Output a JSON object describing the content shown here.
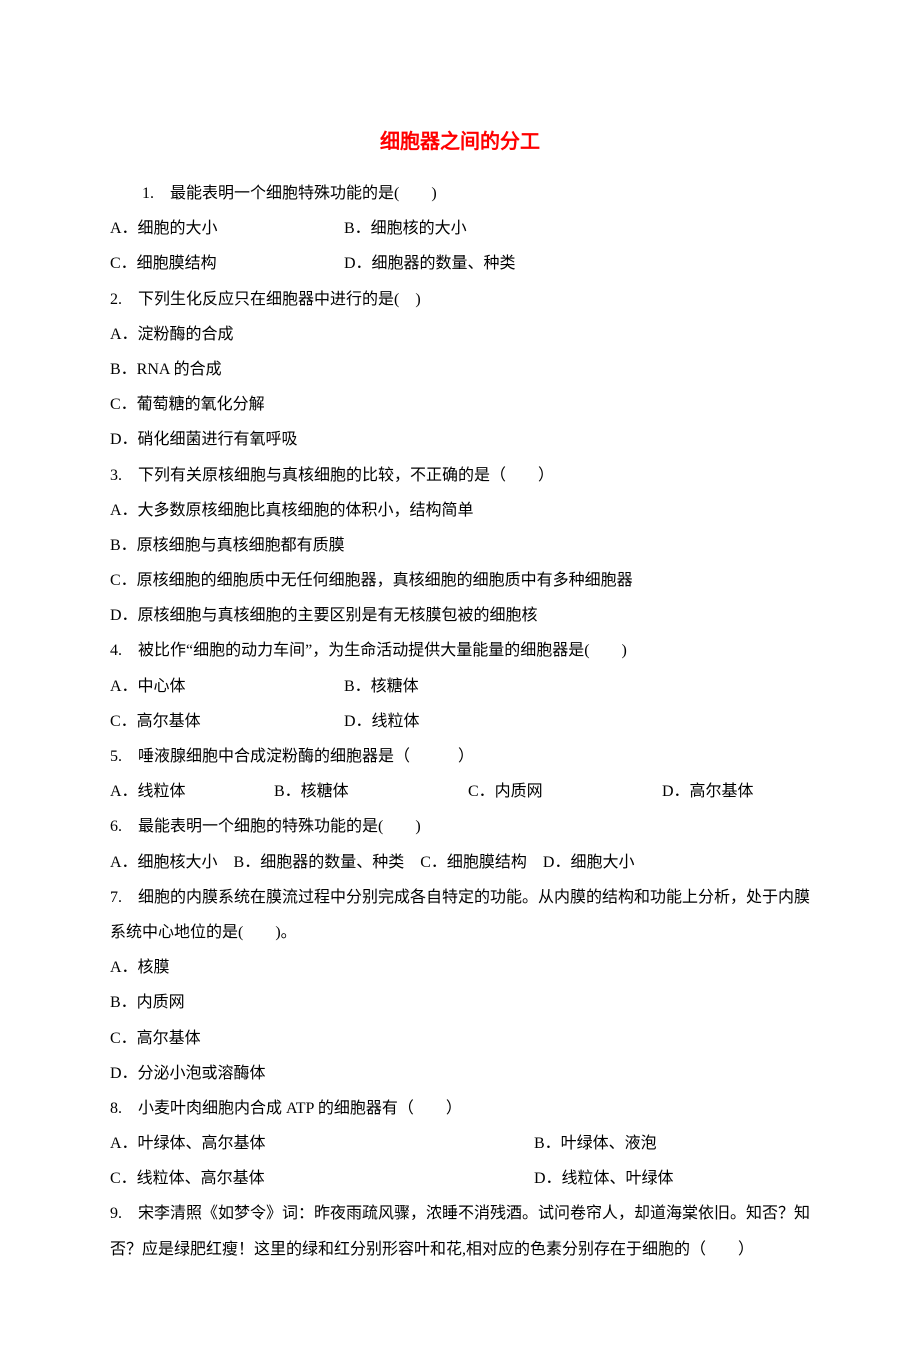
{
  "title": "细胞器之间的分工",
  "q1": {
    "stem": "1.　最能表明一个细胞特殊功能的是(　　)",
    "optA": "A．细胞的大小",
    "optB": "B．细胞核的大小",
    "optC": "C．细胞膜结构",
    "optD": "D．细胞器的数量、种类"
  },
  "q2": {
    "stem": "2.　下列生化反应只在细胞器中进行的是(　)",
    "optA": "A．淀粉酶的合成",
    "optB": "B．RNA 的合成",
    "optC": "C．葡萄糖的氧化分解",
    "optD": "D．硝化细菌进行有氧呼吸"
  },
  "q3": {
    "stem": "3.　下列有关原核细胞与真核细胞的比较，不正确的是（　　）",
    "optA": "A．大多数原核细胞比真核细胞的体积小，结构简单",
    "optB": "B．原核细胞与真核细胞都有质膜",
    "optC": "C．原核细胞的细胞质中无任何细胞器，真核细胞的细胞质中有多种细胞器",
    "optD": "D．原核细胞与真核细胞的主要区别是有无核膜包被的细胞核"
  },
  "q4": {
    "stem": "4.　被比作“细胞的动力车间”，为生命活动提供大量能量的细胞器是(　　)",
    "optA": "A．中心体",
    "optB": "B．核糖体",
    "optC": "C．高尔基体",
    "optD": "D．线粒体"
  },
  "q5": {
    "stem": "5.　唾液腺细胞中合成淀粉酶的细胞器是（　　　）",
    "optA": "A．线粒体",
    "optB": "B．核糖体",
    "optC": "C．内质网",
    "optD": "D．高尔基体"
  },
  "q6": {
    "stem": "6.　最能表明一个细胞的特殊功能的是(　　)",
    "opts": "A．细胞核大小　B．细胞器的数量、种类　C．细胞膜结构　D．细胞大小"
  },
  "q7": {
    "stem": "7.　细胞的内膜系统在膜流过程中分别完成各自特定的功能。从内膜的结构和功能上分析，处于内膜系统中心地位的是(　　)。",
    "optA": "A．核膜",
    "optB": "B．内质网",
    "optC": "C．高尔基体",
    "optD": "D．分泌小泡或溶酶体"
  },
  "q8": {
    "stem": "8.　小麦叶肉细胞内合成 ATP 的细胞器有（　　）",
    "optA": "A．叶绿体、高尔基体",
    "optB": "B．叶绿体、液泡",
    "optC": "C．线粒体、高尔基体",
    "optD": "D．线粒体、叶绿体"
  },
  "q9": {
    "stem": "9.　宋李清照《如梦令》词：昨夜雨疏风骤，浓睡不消残酒。试问卷帘人，却道海棠依旧。知否？知否？应是绿肥红瘦！这里的绿和红分别形容叶和花,相对应的色素分别存在于细胞的（　　）"
  }
}
